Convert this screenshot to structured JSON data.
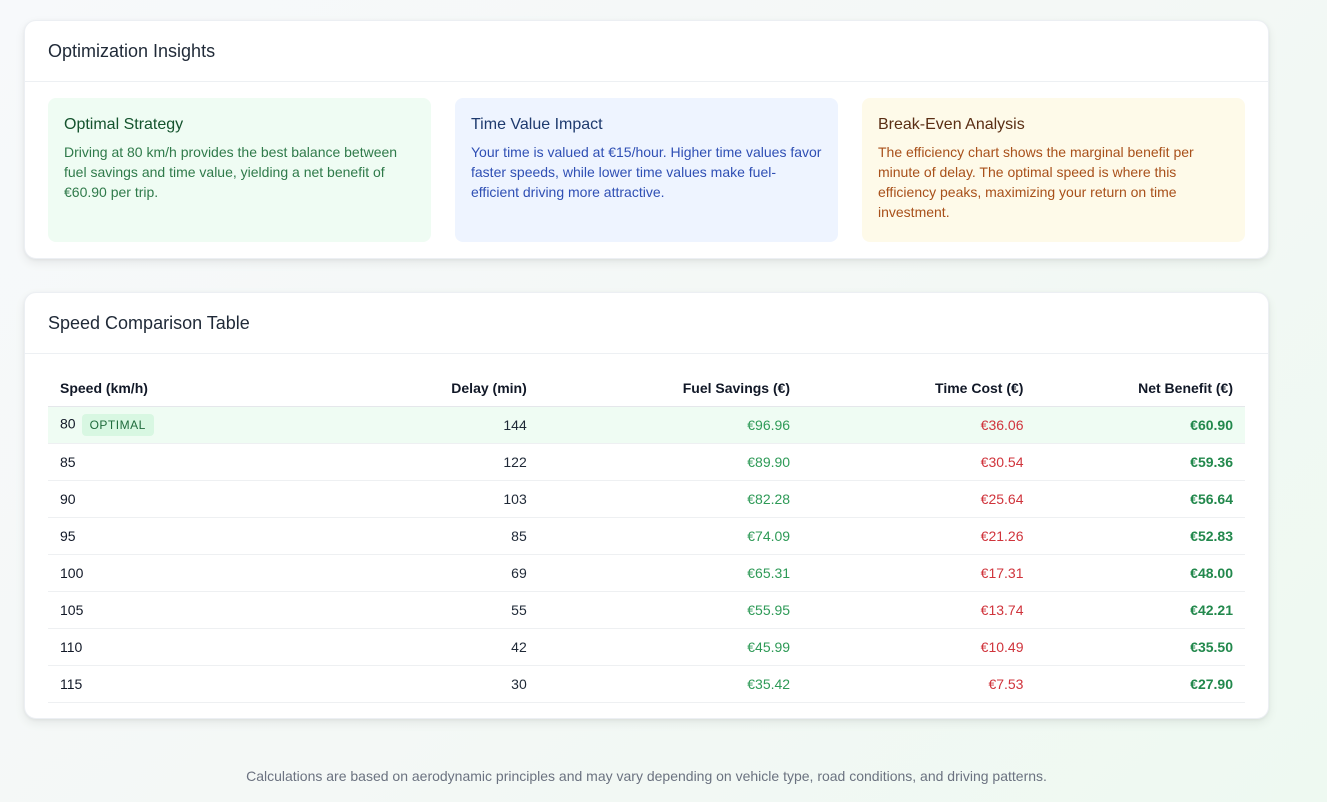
{
  "insights": {
    "title": "Optimization Insights",
    "boxes": [
      {
        "title": "Optimal Strategy",
        "text": "Driving at 80 km/h provides the best balance between fuel savings and time value, yielding a net benefit of €60.90 per trip."
      },
      {
        "title": "Time Value Impact",
        "text": "Your time is valued at €15/hour. Higher time values favor faster speeds, while lower time values make fuel-efficient driving more attractive."
      },
      {
        "title": "Break-Even Analysis",
        "text": "The efficiency chart shows the marginal benefit per minute of delay. The optimal speed is where this efficiency peaks, maximizing your return on time investment."
      }
    ]
  },
  "table": {
    "title": "Speed Comparison Table",
    "columns": [
      "Speed (km/h)",
      "Delay (min)",
      "Fuel Savings (€)",
      "Time Cost (€)",
      "Net Benefit (€)"
    ],
    "optimal_badge": "OPTIMAL",
    "rows": [
      {
        "speed": "80",
        "delay": "144",
        "fuel": "€96.96",
        "cost": "€36.06",
        "net": "€60.90",
        "optimal": true
      },
      {
        "speed": "85",
        "delay": "122",
        "fuel": "€89.90",
        "cost": "€30.54",
        "net": "€59.36",
        "optimal": false
      },
      {
        "speed": "90",
        "delay": "103",
        "fuel": "€82.28",
        "cost": "€25.64",
        "net": "€56.64",
        "optimal": false
      },
      {
        "speed": "95",
        "delay": "85",
        "fuel": "€74.09",
        "cost": "€21.26",
        "net": "€52.83",
        "optimal": false
      },
      {
        "speed": "100",
        "delay": "69",
        "fuel": "€65.31",
        "cost": "€17.31",
        "net": "€48.00",
        "optimal": false
      },
      {
        "speed": "105",
        "delay": "55",
        "fuel": "€55.95",
        "cost": "€13.74",
        "net": "€42.21",
        "optimal": false
      },
      {
        "speed": "110",
        "delay": "42",
        "fuel": "€45.99",
        "cost": "€10.49",
        "net": "€35.50",
        "optimal": false
      },
      {
        "speed": "115",
        "delay": "30",
        "fuel": "€35.42",
        "cost": "€7.53",
        "net": "€27.90",
        "optimal": false
      }
    ]
  },
  "footer": {
    "note": "Calculations are based on aerodynamic principles and may vary depending on vehicle type, road conditions, and driving patterns."
  }
}
